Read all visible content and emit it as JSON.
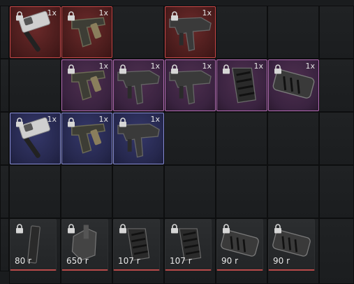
{
  "colors": {
    "epic_border": "#c84848",
    "rare_border": "#b56db6",
    "uncommon_border": "#8a8fd8",
    "price_underline": "#b94a4a"
  },
  "inventory": [
    {
      "row": 0,
      "col": 0,
      "rarity": "red",
      "icon": "sledgehammer-icon",
      "qty": "1x",
      "locked": true
    },
    {
      "row": 0,
      "col": 1,
      "rarity": "red",
      "icon": "pistol-icon",
      "qty": "1x",
      "locked": true
    },
    {
      "row": 0,
      "col": 3,
      "rarity": "red",
      "icon": "smg-icon",
      "qty": "1x",
      "locked": true
    },
    {
      "row": 1,
      "col": 1,
      "rarity": "purple",
      "icon": "pistol-icon",
      "qty": "1x",
      "locked": true
    },
    {
      "row": 1,
      "col": 2,
      "rarity": "purple",
      "icon": "smg-icon",
      "qty": "1x",
      "locked": true
    },
    {
      "row": 1,
      "col": 3,
      "rarity": "purple",
      "icon": "smg-icon",
      "qty": "1x",
      "locked": true
    },
    {
      "row": 1,
      "col": 4,
      "rarity": "purple",
      "icon": "foregrip-icon",
      "qty": "1x",
      "locked": true
    },
    {
      "row": 1,
      "col": 5,
      "rarity": "purple",
      "icon": "muzzle-brake-icon",
      "qty": "1x",
      "locked": true
    },
    {
      "row": 2,
      "col": 0,
      "rarity": "blue",
      "icon": "sledgehammer-icon",
      "qty": "1x",
      "locked": true
    },
    {
      "row": 2,
      "col": 1,
      "rarity": "blue",
      "icon": "pistol-icon",
      "qty": "1x",
      "locked": true
    },
    {
      "row": 2,
      "col": 2,
      "rarity": "blue",
      "icon": "smg-icon",
      "qty": "1x",
      "locked": true
    }
  ],
  "shop": [
    {
      "col": 0,
      "icon": "magazine-icon",
      "price": "80 r",
      "locked": true
    },
    {
      "col": 1,
      "icon": "holster-icon",
      "price": "650 r",
      "locked": true
    },
    {
      "col": 2,
      "icon": "foregrip-icon",
      "price": "107 r",
      "locked": true
    },
    {
      "col": 3,
      "icon": "foregrip-icon",
      "price": "107 r",
      "locked": true
    },
    {
      "col": 4,
      "icon": "muzzle-brake-icon",
      "price": "90 r",
      "locked": true
    },
    {
      "col": 5,
      "icon": "muzzle-brake-icon",
      "price": "90 r",
      "locked": true
    }
  ]
}
